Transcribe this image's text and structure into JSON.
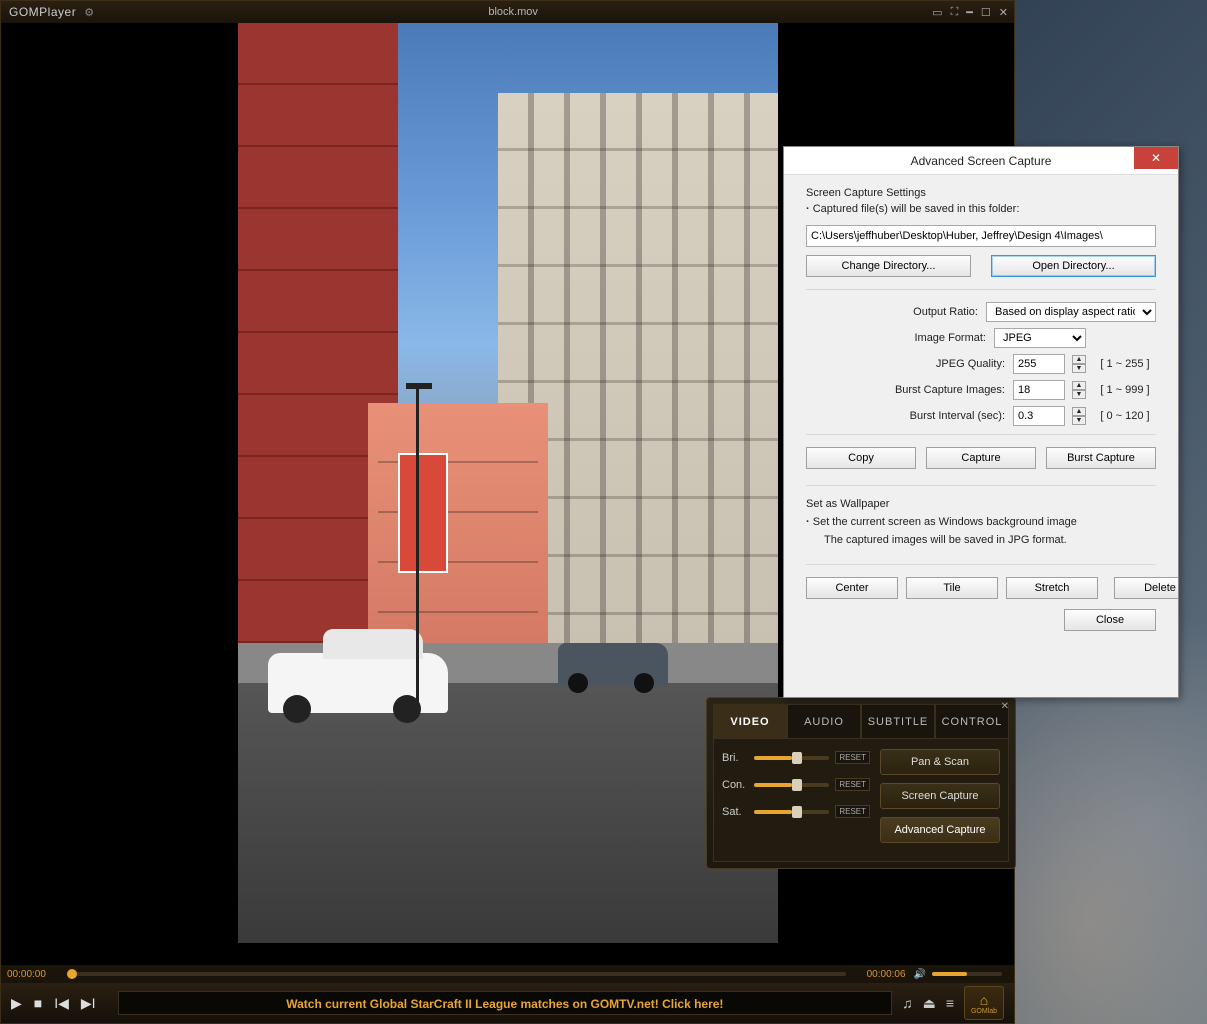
{
  "gom": {
    "logo_prefix": "GOM",
    "logo_suffix": "Player",
    "file_title": "block.mov",
    "seek_left": "00:00:00",
    "seek_right": "00:00:06",
    "marquee": "Watch current Global StarCraft II League matches on GOMTV.net! Click here!",
    "home_label": "GOMlab"
  },
  "panel": {
    "tabs": [
      "VIDEO",
      "AUDIO",
      "SUBTITLE",
      "CONTROL"
    ],
    "sliders": {
      "bri": "Bri.",
      "con": "Con.",
      "sat": "Sat.",
      "reset": "RESET"
    },
    "buttons": {
      "panscan": "Pan & Scan",
      "screencap": "Screen Capture",
      "advcap": "Advanced Capture"
    }
  },
  "dialog": {
    "title": "Advanced Screen Capture",
    "section1_title": "Screen Capture Settings",
    "section1_note": "Captured file(s) will be saved in this folder:",
    "path": "C:\\Users\\jeffhuber\\Desktop\\Huber, Jeffrey\\Design 4\\Images\\",
    "change_dir": "Change Directory...",
    "open_dir": "Open Directory...",
    "output_ratio_label": "Output Ratio:",
    "output_ratio_value": "Based on display aspect ratio",
    "image_format_label": "Image Format:",
    "image_format_value": "JPEG",
    "jpeg_quality_label": "JPEG Quality:",
    "jpeg_quality_value": "255",
    "jpeg_quality_range": "[ 1 ~ 255 ]",
    "burst_images_label": "Burst Capture Images:",
    "burst_images_value": "18",
    "burst_images_range": "[ 1 ~ 999 ]",
    "burst_interval_label": "Burst Interval (sec):",
    "burst_interval_value": "0.3",
    "burst_interval_range": "[ 0 ~ 120 ]",
    "copy": "Copy",
    "capture": "Capture",
    "burst_capture": "Burst Capture",
    "wallpaper_title": "Set as Wallpaper",
    "wallpaper_note": "Set the current screen as Windows background image",
    "wallpaper_sub": "The captured images will be saved in JPG format.",
    "center": "Center",
    "tile": "Tile",
    "stretch": "Stretch",
    "delete": "Delete",
    "close": "Close"
  }
}
